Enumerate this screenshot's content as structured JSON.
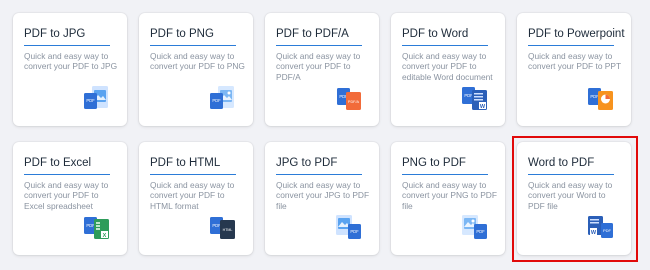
{
  "cards": [
    {
      "title": "PDF to JPG",
      "desc": "Quick and easy way to convert your PDF to JPG",
      "icon": "pdf-to-jpg-icon"
    },
    {
      "title": "PDF to PNG",
      "desc": "Quick and easy way to convert your PDF to PNG",
      "icon": "pdf-to-png-icon"
    },
    {
      "title": "PDF to PDF/A",
      "desc": "Quick and easy way to convert your PDF to PDF/A",
      "icon": "pdf-to-pdfa-icon"
    },
    {
      "title": "PDF to Word",
      "desc": "Quick and easy way to convert your PDF to editable Word document",
      "icon": "pdf-to-word-icon"
    },
    {
      "title": "PDF to Powerpoint",
      "desc": "Quick and easy way to convert your PDF to PPT",
      "icon": "pdf-to-powerpoint-icon"
    },
    {
      "title": "PDF to Excel",
      "desc": "Quick and easy way to convert your PDF to Excel spreadsheet",
      "icon": "pdf-to-excel-icon"
    },
    {
      "title": "PDF to HTML",
      "desc": "Quick and easy way to convert your PDF to HTML format",
      "icon": "pdf-to-html-icon"
    },
    {
      "title": "JPG to PDF",
      "desc": "Quick and easy way to convert your JPG to PDF file",
      "icon": "jpg-to-pdf-icon"
    },
    {
      "title": "PNG to PDF",
      "desc": "Quick and easy way to convert your PNG to PDF file",
      "icon": "png-to-pdf-icon"
    },
    {
      "title": "Word to PDF",
      "desc": "Quick and easy way to convert your Word to PDF file",
      "icon": "word-to-pdf-icon"
    }
  ],
  "highlighted_card": "Word to PDF",
  "colors": {
    "accent_blue": "#2b7cd8",
    "highlight_red": "#e10a0a",
    "pdf_blue": "#2f6fd6",
    "word_blue": "#2b5fb8",
    "png_orange": "#f26b3a",
    "ppt_orange": "#f7931e",
    "excel_green": "#2e9c5a"
  }
}
